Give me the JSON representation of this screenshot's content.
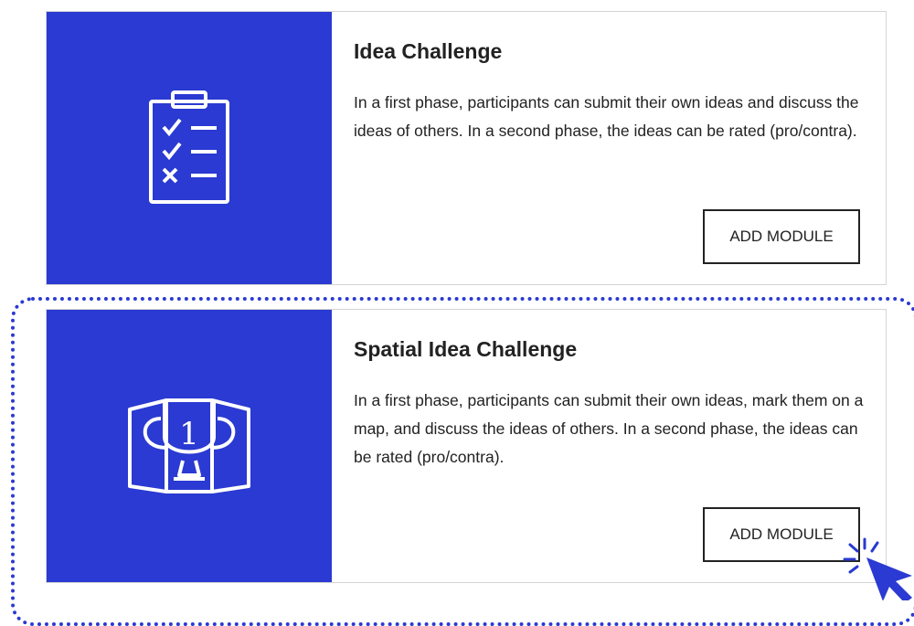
{
  "modules": [
    {
      "title": "Idea Challenge",
      "description": "In a first phase, participants can submit their own ideas and discuss the ideas of others. In a second phase, the ideas can be rated (pro/contra).",
      "button_label": "ADD MODULE",
      "icon": "clipboard-checklist-icon"
    },
    {
      "title": "Spatial Idea Challenge",
      "description": "In a first phase, participants can submit their own ideas, mark them on a map, and discuss the ideas of others. In a second phase, the ideas can be rated (pro/contra).",
      "button_label": "ADD MODULE",
      "icon": "trophy-map-icon"
    }
  ],
  "colors": {
    "accent": "#2a3ad2",
    "highlight_border": "#2a3ad2",
    "card_border": "#d4d4d4"
  },
  "cursor_icon": "pointer-arrow-click-icon"
}
